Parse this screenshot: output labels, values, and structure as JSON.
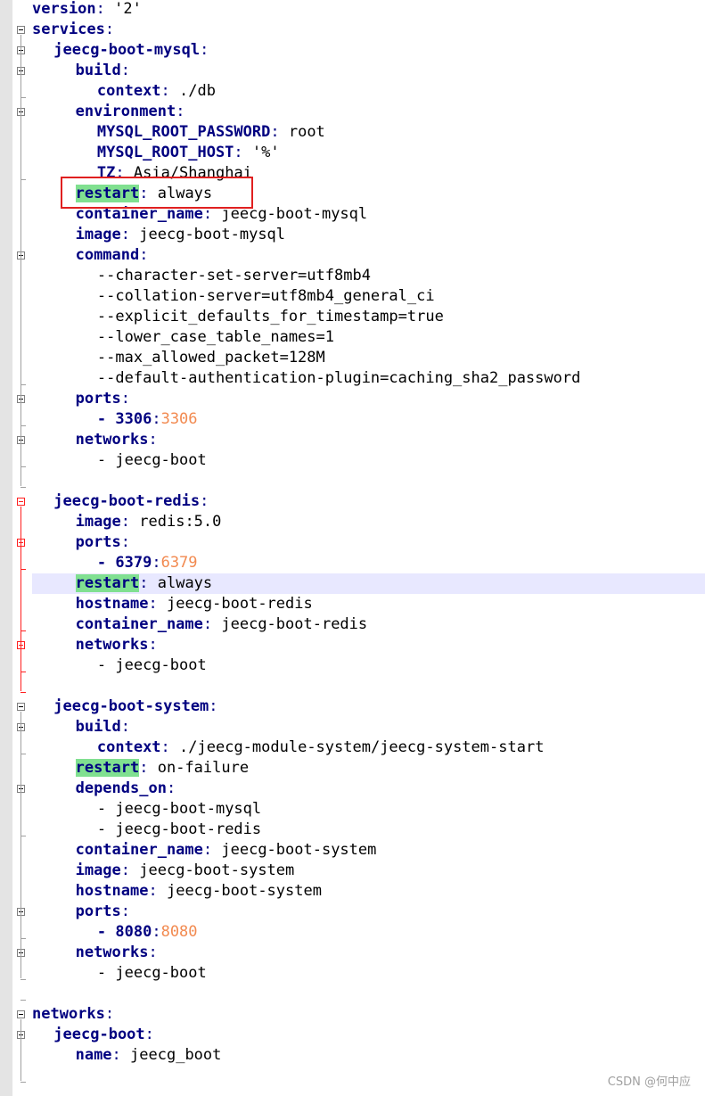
{
  "watermark": "CSDN @何中应",
  "lines": [
    {
      "indent": 0,
      "key": "version",
      "colon": ": ",
      "value": "'2'"
    },
    {
      "indent": 0,
      "key": "services",
      "colon": ":"
    },
    {
      "indent": 1,
      "key": "jeecg-boot-mysql",
      "colon": ":"
    },
    {
      "indent": 2,
      "key": "build",
      "colon": ":"
    },
    {
      "indent": 3,
      "key": "context",
      "colon": ": ",
      "value": "./db"
    },
    {
      "indent": 2,
      "key": "environment",
      "colon": ":"
    },
    {
      "indent": 3,
      "key": "MYSQL_ROOT_PASSWORD",
      "colon": ": ",
      "value": "root"
    },
    {
      "indent": 3,
      "key": "MYSQL_ROOT_HOST",
      "colon": ": ",
      "value": "'%'"
    },
    {
      "indent": 3,
      "key": "TZ",
      "colon": ": ",
      "value": "Asia/Shanghai"
    },
    {
      "indent": 2,
      "key": "restart",
      "colon": ": ",
      "value": "always",
      "hl": true
    },
    {
      "indent": 2,
      "key": "container_name",
      "colon": ": ",
      "value": "jeecg-boot-mysql"
    },
    {
      "indent": 2,
      "key": "image",
      "colon": ": ",
      "value": "jeecg-boot-mysql"
    },
    {
      "indent": 2,
      "key": "command",
      "colon": ":"
    },
    {
      "indent": 3,
      "plain": "--character-set-server=utf8mb4"
    },
    {
      "indent": 3,
      "plain": "--collation-server=utf8mb4_general_ci"
    },
    {
      "indent": 3,
      "plain": "--explicit_defaults_for_timestamp=true"
    },
    {
      "indent": 3,
      "plain": "--lower_case_table_names=1"
    },
    {
      "indent": 3,
      "plain": "--max_allowed_packet=128M"
    },
    {
      "indent": 3,
      "plain": "--default-authentication-plugin=caching_sha2_password"
    },
    {
      "indent": 2,
      "key": "ports",
      "colon": ":"
    },
    {
      "indent": 3,
      "port": true,
      "dash": "- ",
      "num": "3306",
      "colon": ":",
      "value": "3306"
    },
    {
      "indent": 2,
      "key": "networks",
      "colon": ":"
    },
    {
      "indent": 3,
      "dash": "- ",
      "value": "jeecg-boot"
    },
    {
      "indent": 0,
      "blank": true
    },
    {
      "indent": 1,
      "key": "jeecg-boot-redis",
      "colon": ":"
    },
    {
      "indent": 2,
      "key": "image",
      "colon": ": ",
      "value": "redis:5.0"
    },
    {
      "indent": 2,
      "key": "ports",
      "colon": ":"
    },
    {
      "indent": 3,
      "port": true,
      "dash": "- ",
      "num": "6379",
      "colon": ":",
      "value": "6379"
    },
    {
      "indent": 2,
      "key": "restart",
      "colon": ": ",
      "value": "always",
      "hl": true,
      "current": true
    },
    {
      "indent": 2,
      "key": "hostname",
      "colon": ": ",
      "value": "jeecg-boot-redis"
    },
    {
      "indent": 2,
      "key": "container_name",
      "colon": ": ",
      "value": "jeecg-boot-redis"
    },
    {
      "indent": 2,
      "key": "networks",
      "colon": ":"
    },
    {
      "indent": 3,
      "dash": "- ",
      "value": "jeecg-boot"
    },
    {
      "indent": 0,
      "blank": true
    },
    {
      "indent": 1,
      "key": "jeecg-boot-system",
      "colon": ":"
    },
    {
      "indent": 2,
      "key": "build",
      "colon": ":"
    },
    {
      "indent": 3,
      "key": "context",
      "colon": ": ",
      "value": "./jeecg-module-system/jeecg-system-start"
    },
    {
      "indent": 2,
      "key": "restart",
      "colon": ": ",
      "value": "on-failure",
      "hl": true
    },
    {
      "indent": 2,
      "key": "depends_on",
      "colon": ":"
    },
    {
      "indent": 3,
      "dash": "- ",
      "value": "jeecg-boot-mysql"
    },
    {
      "indent": 3,
      "dash": "- ",
      "value": "jeecg-boot-redis"
    },
    {
      "indent": 2,
      "key": "container_name",
      "colon": ": ",
      "value": "jeecg-boot-system"
    },
    {
      "indent": 2,
      "key": "image",
      "colon": ": ",
      "value": "jeecg-boot-system"
    },
    {
      "indent": 2,
      "key": "hostname",
      "colon": ": ",
      "value": "jeecg-boot-system"
    },
    {
      "indent": 2,
      "key": "ports",
      "colon": ":"
    },
    {
      "indent": 3,
      "port": true,
      "dash": "- ",
      "num": "8080",
      "colon": ":",
      "value": "8080"
    },
    {
      "indent": 2,
      "key": "networks",
      "colon": ":"
    },
    {
      "indent": 3,
      "dash": "- ",
      "value": "jeecg-boot"
    },
    {
      "indent": 0,
      "blank": true
    },
    {
      "indent": 0,
      "key": "networks",
      "colon": ":"
    },
    {
      "indent": 1,
      "key": "jeecg-boot",
      "colon": ":"
    },
    {
      "indent": 2,
      "key": "name",
      "colon": ": ",
      "value": "jeecg_boot"
    }
  ]
}
